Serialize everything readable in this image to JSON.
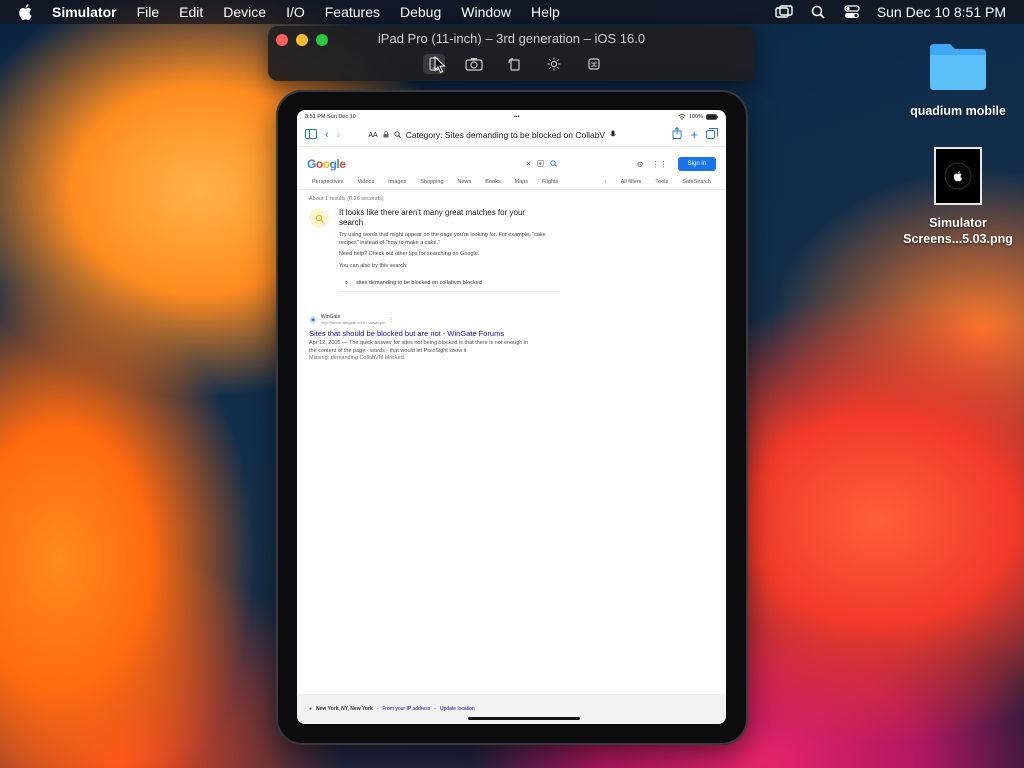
{
  "menubar": {
    "app": "Simulator",
    "items": [
      "File",
      "Edit",
      "Device",
      "I/O",
      "Features",
      "Debug",
      "Window",
      "Help"
    ],
    "clock": "Sun Dec 10  8:51 PM",
    "icons": [
      "screen-mirroring-icon",
      "search-icon",
      "control-center-icon"
    ]
  },
  "simulator": {
    "window_title": "iPad Pro (11-inch) – 3rd generation – iOS 16.0",
    "toolbar_icons": [
      "home-icon",
      "screenshot-icon",
      "rotate-icon",
      "appearance-icon",
      "shortcuts-icon"
    ]
  },
  "ipad": {
    "status_time": "8:51 PM  Sun Dec 10",
    "battery": "100%",
    "url_text": "Category: Sites demanding to be blocked on CollabV",
    "aa": "AA"
  },
  "google": {
    "logo": "Google",
    "signin": "Sign in",
    "tabs": [
      "Perspectives",
      "Videos",
      "Images",
      "Shopping",
      "News",
      "Books",
      "Maps",
      "Flights"
    ],
    "tabs_right": [
      "All filters",
      "Tools",
      "SafeSearch"
    ],
    "stats": "About 1 results (0.26 seconds)",
    "no_match_title": "It looks like there aren't many great matches for your search",
    "tip": "Try using words that might appear on the page you're looking for. For example, \"cake recipes\" instead of \"how to make a cake.\"",
    "help": "Need help? Check out other tips for searching on Google.",
    "also_try": "You can also try this search:",
    "alt_search": "sites demanding to be blocked on collabvm blocked",
    "result": {
      "site": "WinGate",
      "url": "http://forum.wingate.com › viewtopic",
      "title": "Sites that should be blocked but are not - WinGate Forums",
      "snippet": "Apr 12, 2005 — The quick answer for sites not being blocked is that there is not enough in the content of the page - words - that would let PureSight know it",
      "missing": "Missing: demanding CollabVM blocked"
    },
    "footer_location": "New York, NY, New York",
    "footer_from": "From your IP address",
    "footer_update": "Update location"
  },
  "desktop": {
    "folder_label": "quadium mobile",
    "file_label_1": "Simulator",
    "file_label_2": "Screens...5.03.png"
  },
  "colors": {
    "accent": "#1a73e8",
    "link": "#1a0dab",
    "traffic_red": "#ff5f57",
    "traffic_yellow": "#febc2e",
    "traffic_green": "#28c840"
  }
}
